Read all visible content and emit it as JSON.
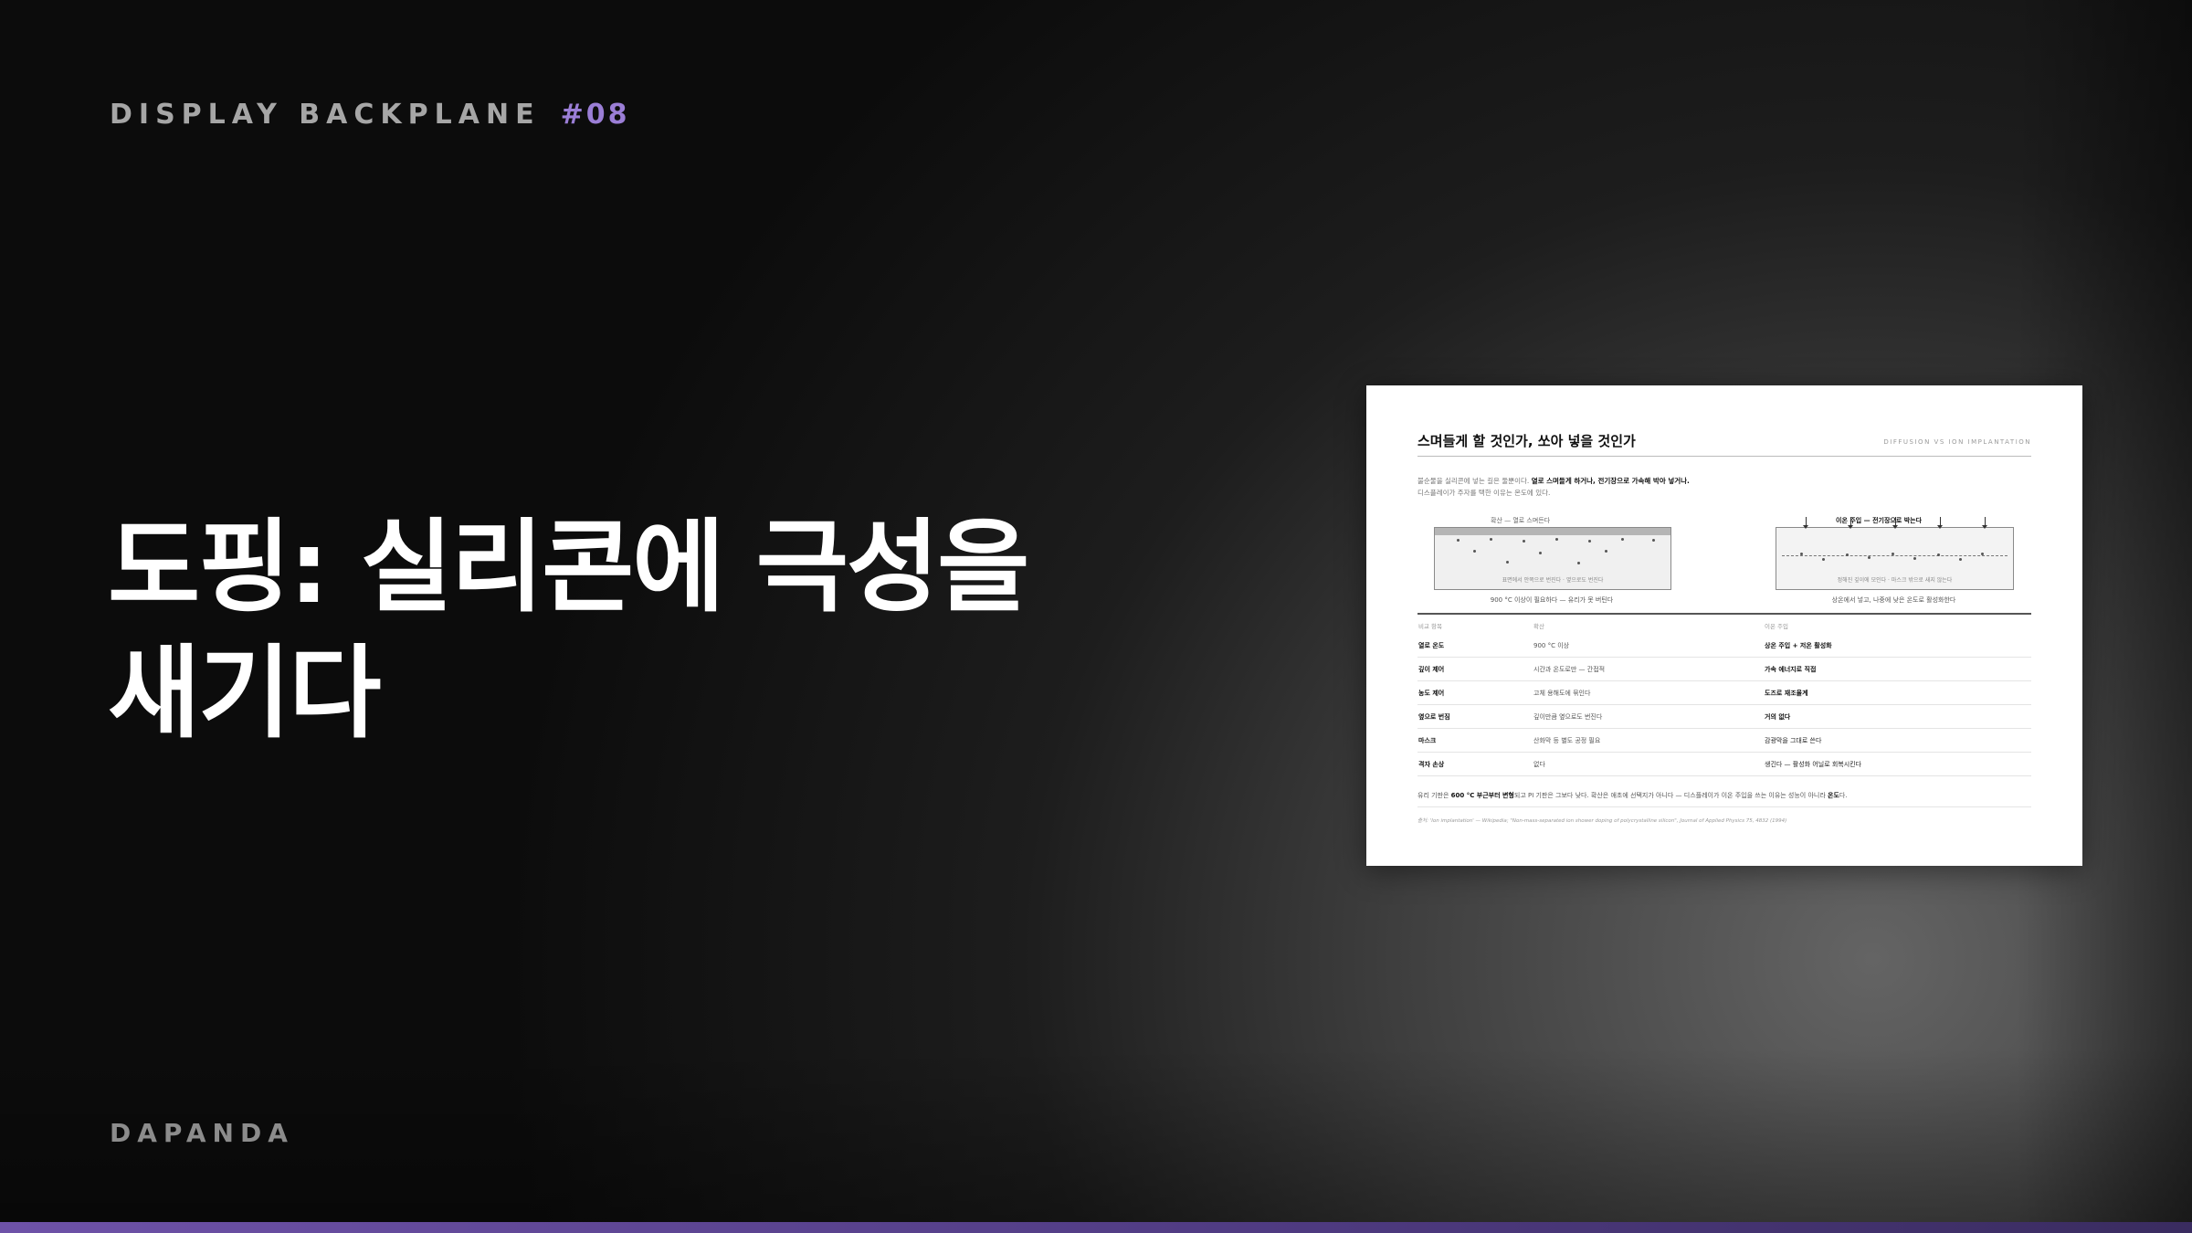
{
  "header": {
    "series": "DISPLAY BACKPLANE",
    "number": "#08"
  },
  "headline": {
    "line1": "도핑: 실리콘에 극성을",
    "line2": "새기다"
  },
  "brand": "DAPANDA",
  "colors": {
    "accent": "#9b7ed6",
    "bar": "#6e52a8"
  },
  "slide": {
    "title": "스며들게 할 것인가, 쏘아 넣을 것인가",
    "tag": "DIFFUSION VS ION IMPLANTATION",
    "intro": {
      "lead": "불순물을 실리콘에 넣는 길은 둘뿐이다.",
      "strong": "열로 스며들게 하거나, 전기장으로 가속해 박아 넣거나.",
      "line2": "디스플레이가 주자를 택한 이유는 온도에 있다."
    },
    "left_panel": {
      "label": "확산 — 열로 스며든다",
      "inner_note": "표면에서 안쪽으로 번진다 · 옆으로도 번진다",
      "caption": "900 °C 이상이 필요하다 — 유리가 못 버틴다"
    },
    "right_panel": {
      "label": "이온 주입 — 전기장으로 박는다",
      "inner_note": "정해진 깊이에 모인다 · 마스크 밖으로 새지 않는다",
      "caption": "상온에서 넣고, 나중에 낮은 온도로 활성화한다"
    },
    "table": {
      "headers": [
        "비교 항목",
        "확산",
        "이온 주입"
      ],
      "rows": [
        {
          "key": "열로 온도",
          "diffusion": "900 °C 이상",
          "implant_bold": "상온 주입 + 저온 활성화",
          "implant": ""
        },
        {
          "key": "깊이 제어",
          "diffusion": "시간과 온도로만 — 간접적",
          "implant_bold": "가속 에너지로 직접",
          "implant": ""
        },
        {
          "key": "농도 제어",
          "diffusion": "고체 용해도에 묶인다",
          "implant_bold": "도즈로 재조율계",
          "implant": ""
        },
        {
          "key": "옆으로 번짐",
          "diffusion": "깊이만큼 옆으로도 번진다",
          "implant_bold": "거의 없다",
          "implant": ""
        },
        {
          "key": "마스크",
          "diffusion": "산화막 등 별도 공정 필요",
          "implant_bold": "",
          "implant": "감광막을 그대로 쓴다"
        },
        {
          "key": "격자 손상",
          "diffusion": "없다",
          "implant_bold": "",
          "implant": "생긴다 — 활성화 어닐로 회복시킨다"
        }
      ]
    },
    "summary": {
      "p1": "유리 기판은",
      "b1": "600 °C 부근부터 변형",
      "p2": "되고 PI 기판은 그보다 낮다. 확산은 애초에 선택지가 아니다 — 디스플레이가 이온 주입을 쓰는 이유는 성능이 아니라",
      "b2": "온도",
      "p3": "다."
    },
    "source": "출처: 'Ion implantation' — Wikipedia; \"Non-mass-separated ion shower doping of polycrystalline silicon\", Journal of Applied Physics 75, 4832 (1994)"
  }
}
